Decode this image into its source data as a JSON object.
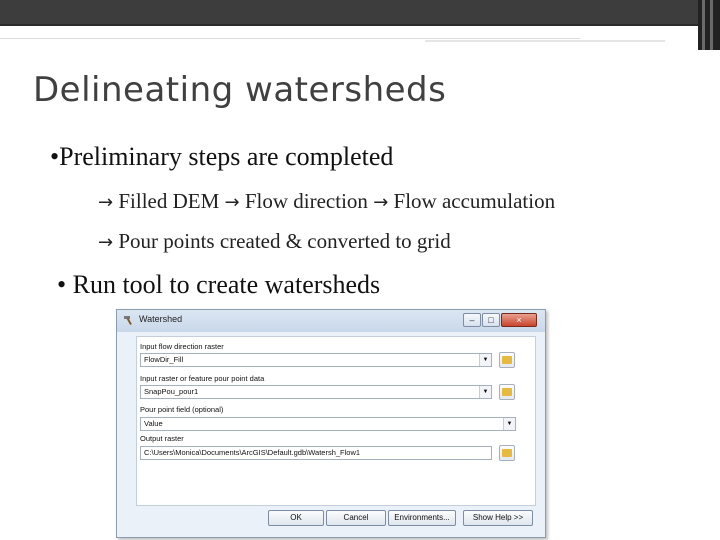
{
  "slide": {
    "title": "Delineating watersheds",
    "bullet1": "•Preliminary steps are completed",
    "sub1": {
      "a": "Filled DEM",
      "b": "Flow direction",
      "c": "Flow accumulation"
    },
    "sub2": "Pour points created & converted to grid",
    "bullet2": "• Run tool to create watersheds",
    "arrow_glyph": "→"
  },
  "dialog": {
    "title": "Watershed",
    "fields": [
      {
        "label": "Input flow direction raster",
        "value": "FlowDir_Fill"
      },
      {
        "label": "Input raster or feature pour point data",
        "value": "SnapPou_pour1"
      },
      {
        "label": "Pour point field (optional)",
        "value": "Value"
      },
      {
        "label": "Output raster",
        "value": "C:\\Users\\Monica\\Documents\\ArcGIS\\Default.gdb\\Watersh_Flow1"
      }
    ],
    "buttons": {
      "ok": "OK",
      "cancel": "Cancel",
      "environments": "Environments...",
      "help": "Show Help >>"
    },
    "icons": {
      "title": "hammer-icon",
      "browse": "folder-icon"
    }
  }
}
